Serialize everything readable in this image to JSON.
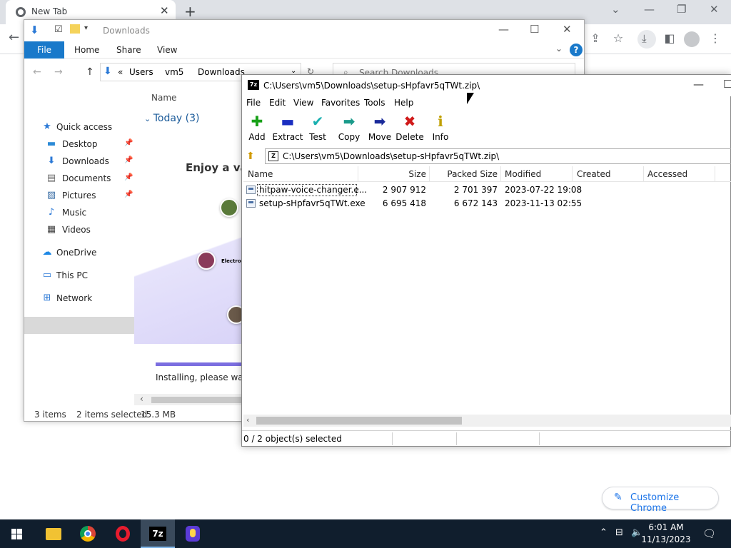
{
  "chrome": {
    "tab_title": "New Tab",
    "tab_close": "✕",
    "new_tab": "+",
    "customize_label": "Customize Chrome",
    "controls": {
      "minimize": "—",
      "restore": "❐",
      "close": "✕",
      "chevron": "⌄"
    }
  },
  "explorer": {
    "title": "Downloads",
    "ribbon": {
      "file": "File",
      "home": "Home",
      "share": "Share",
      "view": "View"
    },
    "address": {
      "crumb_prefix": "«",
      "crumbs": [
        "Users",
        "vm5",
        "Downloads"
      ]
    },
    "search_placeholder": "Search Downloads",
    "nav": [
      {
        "label": "Quick access",
        "icon": "★",
        "color": "#2b79d6",
        "pinned": false
      },
      {
        "label": "Desktop",
        "icon": "▬",
        "color": "#2b8ad6",
        "pinned": true
      },
      {
        "label": "Downloads",
        "icon": "⬇",
        "color": "#2b79d6",
        "pinned": true
      },
      {
        "label": "Documents",
        "icon": "▤",
        "color": "#6b6b6b",
        "pinned": true
      },
      {
        "label": "Pictures",
        "icon": "▨",
        "color": "#3a6ea5",
        "pinned": true
      },
      {
        "label": "Music",
        "icon": "♪",
        "color": "#2b79d6",
        "pinned": false
      },
      {
        "label": "Videos",
        "icon": "▦",
        "color": "#444",
        "pinned": false
      },
      {
        "label": "OneDrive",
        "icon": "☁",
        "color": "#1e88e5",
        "pinned": false
      },
      {
        "label": "This PC",
        "icon": "▭",
        "color": "#2b79d6",
        "pinned": false
      },
      {
        "label": "Network",
        "icon": "⊞",
        "color": "#2b79d6",
        "pinned": false
      }
    ],
    "column_name": "Name",
    "group_label": "Today (3)",
    "preview": {
      "heading": "Enjoy a va",
      "avatar_label": "Electro",
      "installing": "Installing, please wai"
    },
    "status": {
      "items": "3 items",
      "selected": "2 items selected",
      "size": "15.3 MB"
    }
  },
  "sevenzip": {
    "title": "C:\\Users\\vm5\\Downloads\\setup-sHpfavr5qTWt.zip\\",
    "logo": "7z",
    "menu": [
      "File",
      "Edit",
      "View",
      "Favorites",
      "Tools",
      "Help"
    ],
    "toolbar": [
      {
        "label": "Add",
        "icon": "✚",
        "color": "#18a018"
      },
      {
        "label": "Extract",
        "icon": "▬",
        "color": "#1a2ec0"
      },
      {
        "label": "Test",
        "icon": "✔",
        "color": "#1ab0b0"
      },
      {
        "label": "Copy",
        "icon": "➡",
        "color": "#1a9a8a"
      },
      {
        "label": "Move",
        "icon": "➡",
        "color": "#1a2a9a"
      },
      {
        "label": "Delete",
        "icon": "✖",
        "color": "#d01a1a"
      },
      {
        "label": "Info",
        "icon": "ℹ",
        "color": "#c0a000"
      }
    ],
    "path": "C:\\Users\\vm5\\Downloads\\setup-sHpfavr5qTWt.zip\\",
    "columns": [
      "Name",
      "Size",
      "Packed Size",
      "Modified",
      "Created",
      "Accessed"
    ],
    "rows": [
      {
        "name": "hitpaw-voice-changer.e...",
        "size": "2 907 912",
        "packed": "2 701 397",
        "modified": "2023-07-22 19:08"
      },
      {
        "name": "setup-sHpfavr5qTWt.exe",
        "size": "6 695 418",
        "packed": "6 672 143",
        "modified": "2023-11-13 02:55"
      }
    ],
    "status": "0 / 2 object(s) selected"
  },
  "taskbar": {
    "time": "6:01 AM",
    "date": "11/13/2023",
    "sevenzip_label": "7z"
  }
}
